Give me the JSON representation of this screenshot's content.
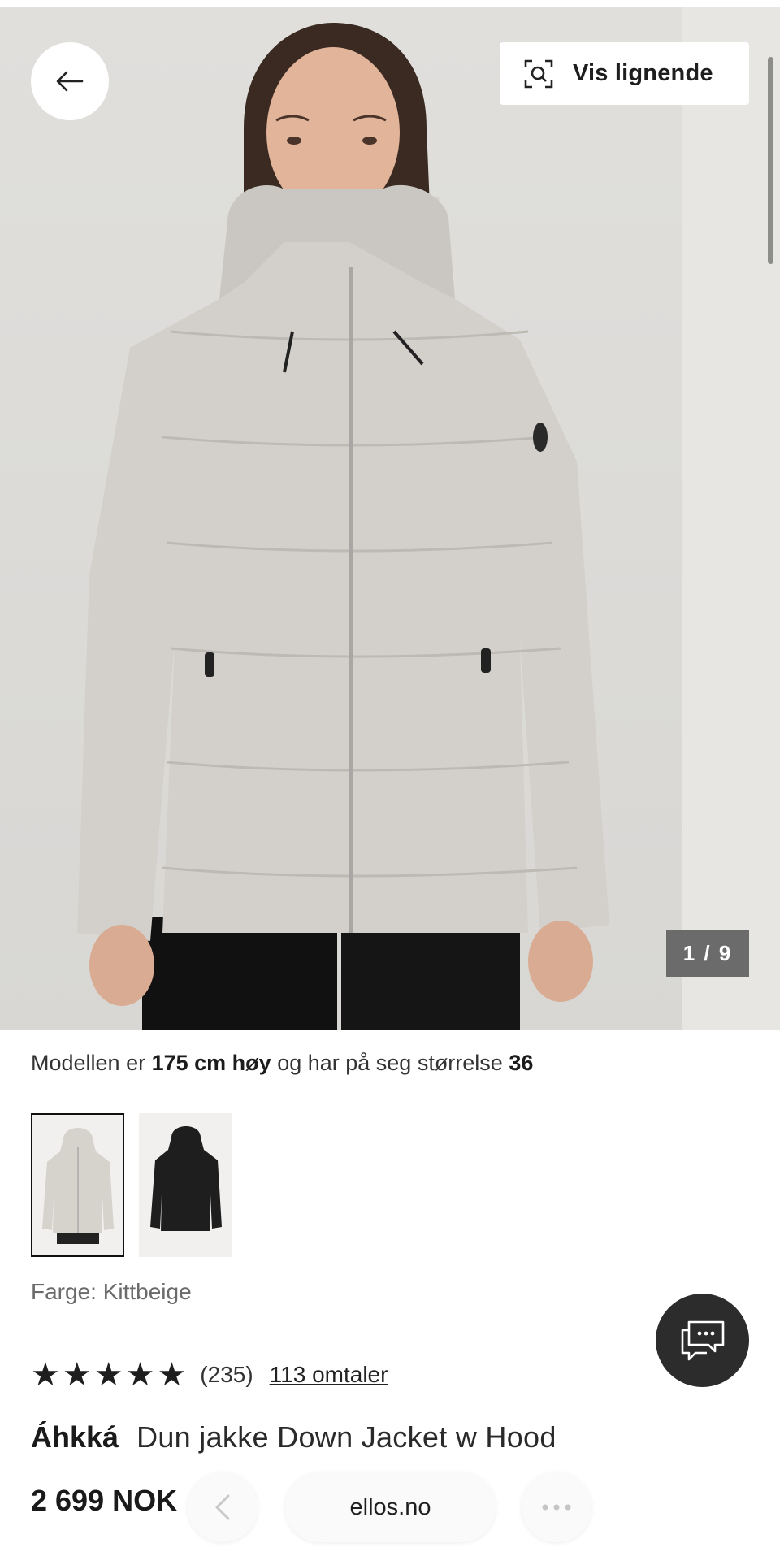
{
  "header": {
    "similar_label": "Vis lignende",
    "icons": {
      "back": "arrow-left-icon",
      "similar": "visual-search-icon"
    }
  },
  "gallery": {
    "counter": "1 / 9"
  },
  "model_info": {
    "prefix": "Modellen er",
    "height": "175 cm høy",
    "middle": "og har på seg størrelse",
    "size": "36"
  },
  "colors": {
    "label": "Farge: Kittbeige",
    "swatches": [
      "light-grey",
      "black"
    ]
  },
  "rating": {
    "stars": 5,
    "count": "(235)",
    "reviews_link": "113 omtaler"
  },
  "product": {
    "brand": "Áhkká",
    "name": "Dun jakke Down Jacket w Hood",
    "price": "2 699 NOK"
  },
  "browser": {
    "url": "ellos.no",
    "icons": {
      "back": "chevron-left-icon",
      "more": "more-dots-icon"
    }
  },
  "chat": {
    "icon": "chat-bubbles-icon"
  },
  "theme": {
    "dark_button": "#2c2c2c",
    "counter_bg": "#6b6b6b",
    "jacket_color": "#d3d0cb"
  }
}
